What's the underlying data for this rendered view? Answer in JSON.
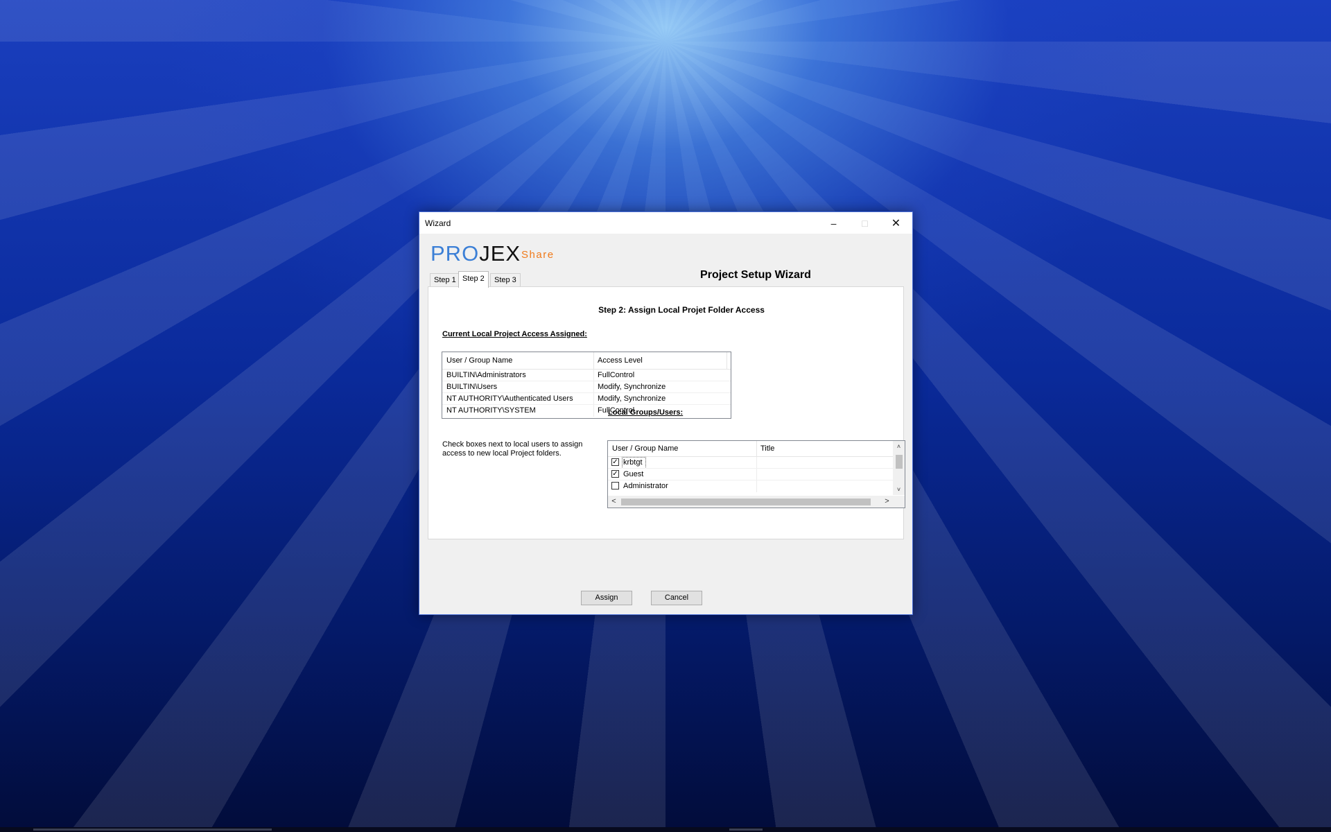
{
  "window": {
    "title": "Wizard",
    "min_glyph": "–",
    "max_glyph": "□",
    "close_glyph": "✕"
  },
  "logo": {
    "pro": "PRO",
    "jex": "JEX",
    "share": "Share"
  },
  "wizard_title": "Project Setup Wizard",
  "tabs": [
    {
      "label": "Step 1",
      "active": false
    },
    {
      "label": "Step 2",
      "active": true
    },
    {
      "label": "Step 3",
      "active": false
    }
  ],
  "step_heading": "Step 2: Assign Local Projet Folder Access",
  "current_access": {
    "label": "Current Local Project Access Assigned:",
    "columns": [
      "User / Group Name",
      "Access Level"
    ],
    "rows": [
      {
        "name": "BUILTIN\\Administrators",
        "access": "FullControl"
      },
      {
        "name": "BUILTIN\\Users",
        "access": "Modify, Synchronize"
      },
      {
        "name": "NT AUTHORITY\\Authenticated Users",
        "access": "Modify, Synchronize"
      },
      {
        "name": "NT AUTHORITY\\SYSTEM",
        "access": "FullControl"
      }
    ]
  },
  "instructions": "Check boxes next to local users to assign access to new local Project folders.",
  "local_groups": {
    "label": "Local Groups/Users:",
    "columns": [
      "User / Group Name",
      "Title"
    ],
    "rows": [
      {
        "name": "krbtgt",
        "title": "",
        "checked": true
      },
      {
        "name": "Guest",
        "title": "",
        "checked": true
      },
      {
        "name": "Administrator",
        "title": "",
        "checked": false
      }
    ],
    "scroll": {
      "up": "˄",
      "down": "˅",
      "left": "<",
      "right": ">"
    },
    "check_glyph": "✓"
  },
  "buttons": {
    "assign": "Assign",
    "cancel": "Cancel"
  },
  "colors": {
    "logo_blue": "#3b7fd6",
    "logo_dark": "#111111",
    "logo_orange": "#f07a1a",
    "window_border": "#4a6fd8"
  }
}
